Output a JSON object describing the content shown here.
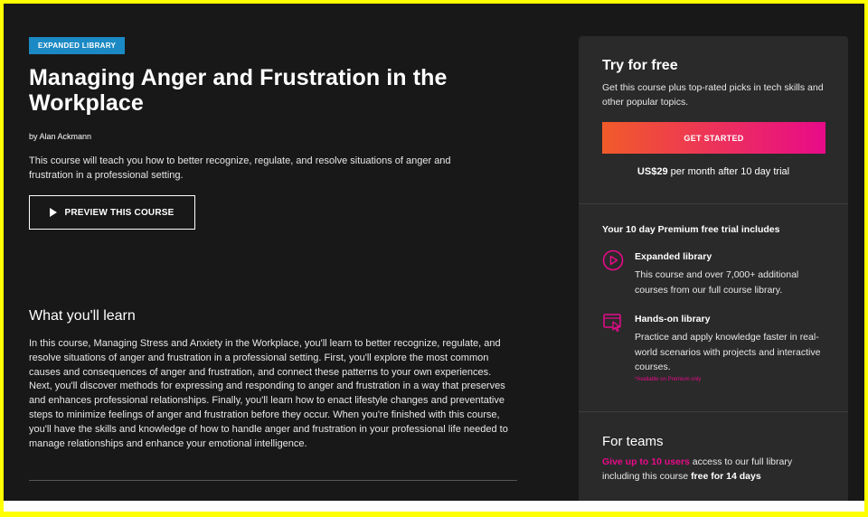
{
  "course": {
    "badge": "EXPANDED LIBRARY",
    "title": "Managing Anger and Frustration in the Workplace",
    "author": "by Alan Ackmann",
    "description": "This course will teach you how to better recognize, regulate, and resolve situations of anger and frustration in a professional setting.",
    "preview_label": "PREVIEW THIS COURSE"
  },
  "learn": {
    "heading": "What you'll learn",
    "body": "In this course, Managing Stress and Anxiety in the Workplace, you'll learn to better recognize, regulate, and resolve situations of anger and frustration in a professional setting. First, you'll explore the most common causes and consequences of anger and frustration, and connect these patterns to your own experiences. Next, you'll discover methods for expressing and responding to anger and frustration in a way that preserves and enhances professional relationships. Finally, you'll learn how to enact lifestyle changes and preventative steps to minimize feelings of anger and frustration before they occur. When you're finished with this course, you'll have the skills and knowledge of how to handle anger and frustration in your professional life needed to manage relationships and enhance your emotional intelligence."
  },
  "sidebar": {
    "try_title": "Try for free",
    "try_text": "Get this course plus top-rated picks in tech skills and other popular topics.",
    "cta_label": "GET STARTED",
    "price_bold": "US$29",
    "price_rest": " per month after 10 day trial",
    "trial_heading": "Your 10 day Premium free trial includes",
    "features": [
      {
        "icon": "play-circle-icon",
        "title": "Expanded library",
        "text": "This course and over 7,000+ additional courses from our full course library."
      },
      {
        "icon": "hands-on-icon",
        "title": "Hands-on library",
        "text": "Practice and apply knowledge faster in real-world scenarios with projects and interactive courses.",
        "note": "*Available on Premium only"
      }
    ],
    "teams_title": "For teams",
    "teams_highlight": "Give up to 10 users",
    "teams_mid": " access to our full library including this course ",
    "teams_bold": "free for 14 days"
  },
  "colors": {
    "accent_pink": "#e80a89",
    "accent_orange": "#f15b2a",
    "badge_blue": "#1b8ac4",
    "frame_yellow": "#ffff00"
  }
}
